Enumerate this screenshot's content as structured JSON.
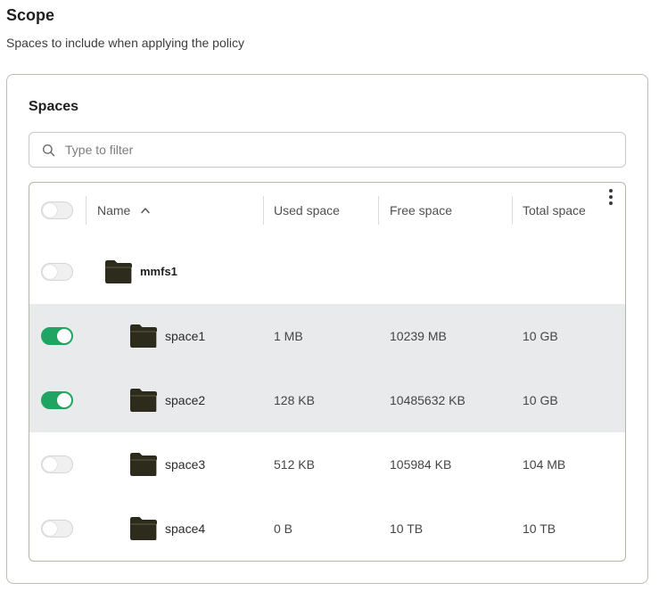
{
  "section": {
    "title": "Scope",
    "subtitle": "Spaces to include when applying the policy"
  },
  "card": {
    "title": "Spaces"
  },
  "search": {
    "placeholder": "Type to filter",
    "value": "",
    "icon": "search-icon"
  },
  "table": {
    "columns": {
      "name": "Name",
      "used": "Used space",
      "free": "Free space",
      "total": "Total space"
    },
    "sort": {
      "column": "name",
      "direction": "ascending",
      "icon": "chevron-up-icon"
    },
    "menu_icon": "more-vertical-icon",
    "header_toggle_on": false,
    "rows": [
      {
        "name": "mmfs1",
        "level": 0,
        "selected": false,
        "icon": "folder-icon"
      },
      {
        "name": "space1",
        "level": 1,
        "selected": true,
        "used": "1 MB",
        "free": "10239 MB",
        "total": "10 GB",
        "icon": "folder-icon"
      },
      {
        "name": "space2",
        "level": 1,
        "selected": true,
        "used": "128 KB",
        "free": "10485632 KB",
        "total": "10 GB",
        "icon": "folder-icon"
      },
      {
        "name": "space3",
        "level": 1,
        "selected": false,
        "used": "512 KB",
        "free": "105984 KB",
        "total": "104 MB",
        "icon": "folder-icon"
      },
      {
        "name": "space4",
        "level": 1,
        "selected": false,
        "used": "0 B",
        "free": "10 TB",
        "total": "10 TB",
        "icon": "folder-icon"
      }
    ]
  },
  "colors": {
    "accent": "#1fa463",
    "selected_row": "#e9eaec",
    "text": "#1f1f1f",
    "folder": "#2c2b1c"
  }
}
